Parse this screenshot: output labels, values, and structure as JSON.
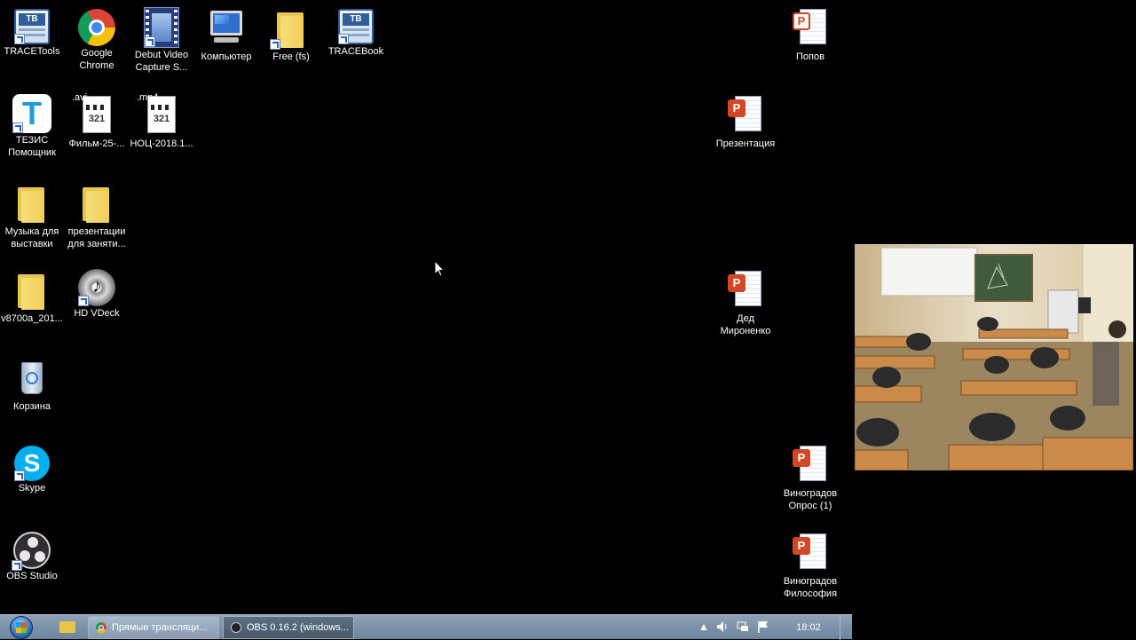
{
  "desktop": {
    "icons": [
      {
        "label": "TRACETools",
        "icon": "trace-tools-icon"
      },
      {
        "label": "Google Chrome",
        "icon": "chrome-icon"
      },
      {
        "label": "Debut Video Capture S...",
        "icon": "film-strip-icon"
      },
      {
        "label": "Компьютер",
        "icon": "computer-icon"
      },
      {
        "label": "Free (fs)",
        "icon": "folder-icon"
      },
      {
        "label": "TRACEBook",
        "icon": "trace-book-icon"
      },
      {
        "label": "ТЕЗИС Помощник",
        "icon": "tezis-icon"
      },
      {
        "label": "Фильм-25-...",
        "icon": "video-file-icon",
        "ext": ".avi"
      },
      {
        "label": "НОЦ-2018.1...",
        "icon": "video-file-icon",
        "ext": ".mp4"
      },
      {
        "label": "Музыка для выставки",
        "icon": "folder-icon"
      },
      {
        "label": "презентации для заняти...",
        "icon": "folder-icon"
      },
      {
        "label": "v8700a_201...",
        "icon": "folder-icon"
      },
      {
        "label": "HD VDeck",
        "icon": "disc-icon"
      },
      {
        "label": "Корзина",
        "icon": "recycle-bin-icon"
      },
      {
        "label": "Skype",
        "icon": "skype-icon"
      },
      {
        "label": "OBS Studio",
        "icon": "obs-icon"
      },
      {
        "label": "Попов",
        "icon": "powerpoint-doc-icon"
      },
      {
        "label": "Презентация",
        "icon": "powerpoint-doc-icon"
      },
      {
        "label": "Дед Мироненко",
        "icon": "powerpoint-doc-icon"
      },
      {
        "label": "Виноградов Опрос (1)",
        "icon": "powerpoint-doc-icon"
      },
      {
        "label": "Виноградов Философия",
        "icon": "powerpoint-doc-icon"
      }
    ],
    "media_num": "321",
    "trace_badge": "TB"
  },
  "taskbar": {
    "buttons": [
      {
        "label": "Прямые трансляци...",
        "icon": "chrome-icon"
      },
      {
        "label": "OBS 0.16.2 (windows...",
        "icon": "obs-icon"
      }
    ],
    "tray": {
      "icons": [
        "show-hidden-icons-arrow",
        "volume-icon",
        "network-icon",
        "action-center-flag-icon"
      ]
    },
    "clock": "18:02"
  },
  "video_preview": {
    "content": "classroom-camera-feed"
  },
  "colors": {
    "desktop_bg": "#000000",
    "taskbar": "#7b90a6",
    "folder": "#f0cf5a",
    "ppt": "#d24726"
  }
}
